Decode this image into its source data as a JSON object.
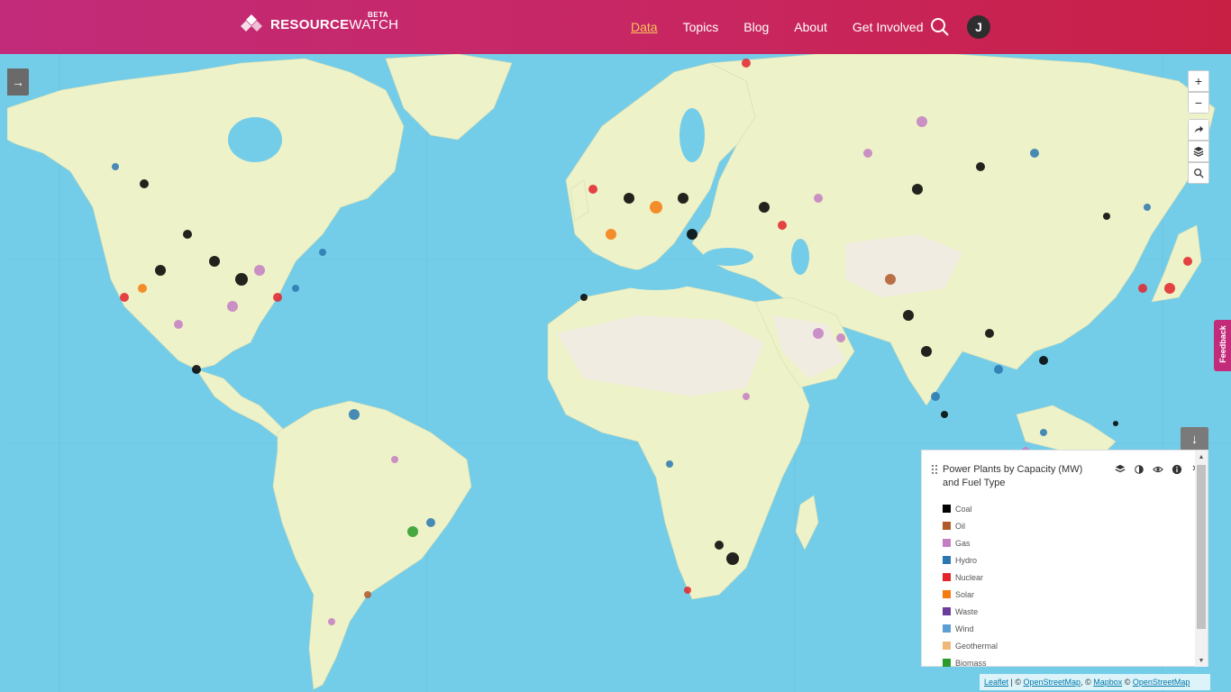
{
  "header": {
    "brand_bold": "RESOURCE",
    "brand_light": "WATCH",
    "beta": "BETA",
    "nav": [
      {
        "label": "Data",
        "active": true
      },
      {
        "label": "Topics",
        "active": false
      },
      {
        "label": "Blog",
        "active": false
      },
      {
        "label": "About",
        "active": false
      },
      {
        "label": "Get Involved",
        "active": false
      }
    ],
    "avatar_initial": "J"
  },
  "map_controls": {
    "zoom_in": "+",
    "zoom_out": "−",
    "share_icon": "share-arrow-icon",
    "layers_icon": "layers-icon",
    "search_icon": "search-icon"
  },
  "feedback": "Feedback",
  "legend": {
    "title": "Power Plants by Capacity (MW) and Fuel Type",
    "items": [
      {
        "label": "Coal",
        "color": "#000000"
      },
      {
        "label": "Oil",
        "color": "#b05a2b"
      },
      {
        "label": "Gas",
        "color": "#c47fc4"
      },
      {
        "label": "Hydro",
        "color": "#2b78b0"
      },
      {
        "label": "Nuclear",
        "color": "#e3242b"
      },
      {
        "label": "Solar",
        "color": "#f47c0f"
      },
      {
        "label": "Waste",
        "color": "#6a3d9a"
      },
      {
        "label": "Wind",
        "color": "#5b9fd4"
      },
      {
        "label": "Geothermal",
        "color": "#f0b878"
      },
      {
        "label": "Biomass",
        "color": "#2a9c2a"
      }
    ]
  },
  "attribution": {
    "leaflet": "Leaflet",
    "sep": " | © ",
    "osm1": "OpenStreetMap",
    "comma": ", © ",
    "mapbox": "Mapbox",
    "comma2": " © ",
    "osm2": "OpenStreetMap"
  },
  "colors": {
    "ocean": "#74cde8",
    "land": "#eef2c8",
    "desert": "#f1ece1",
    "header_start": "#c22b7a",
    "header_end": "#c81f45"
  }
}
